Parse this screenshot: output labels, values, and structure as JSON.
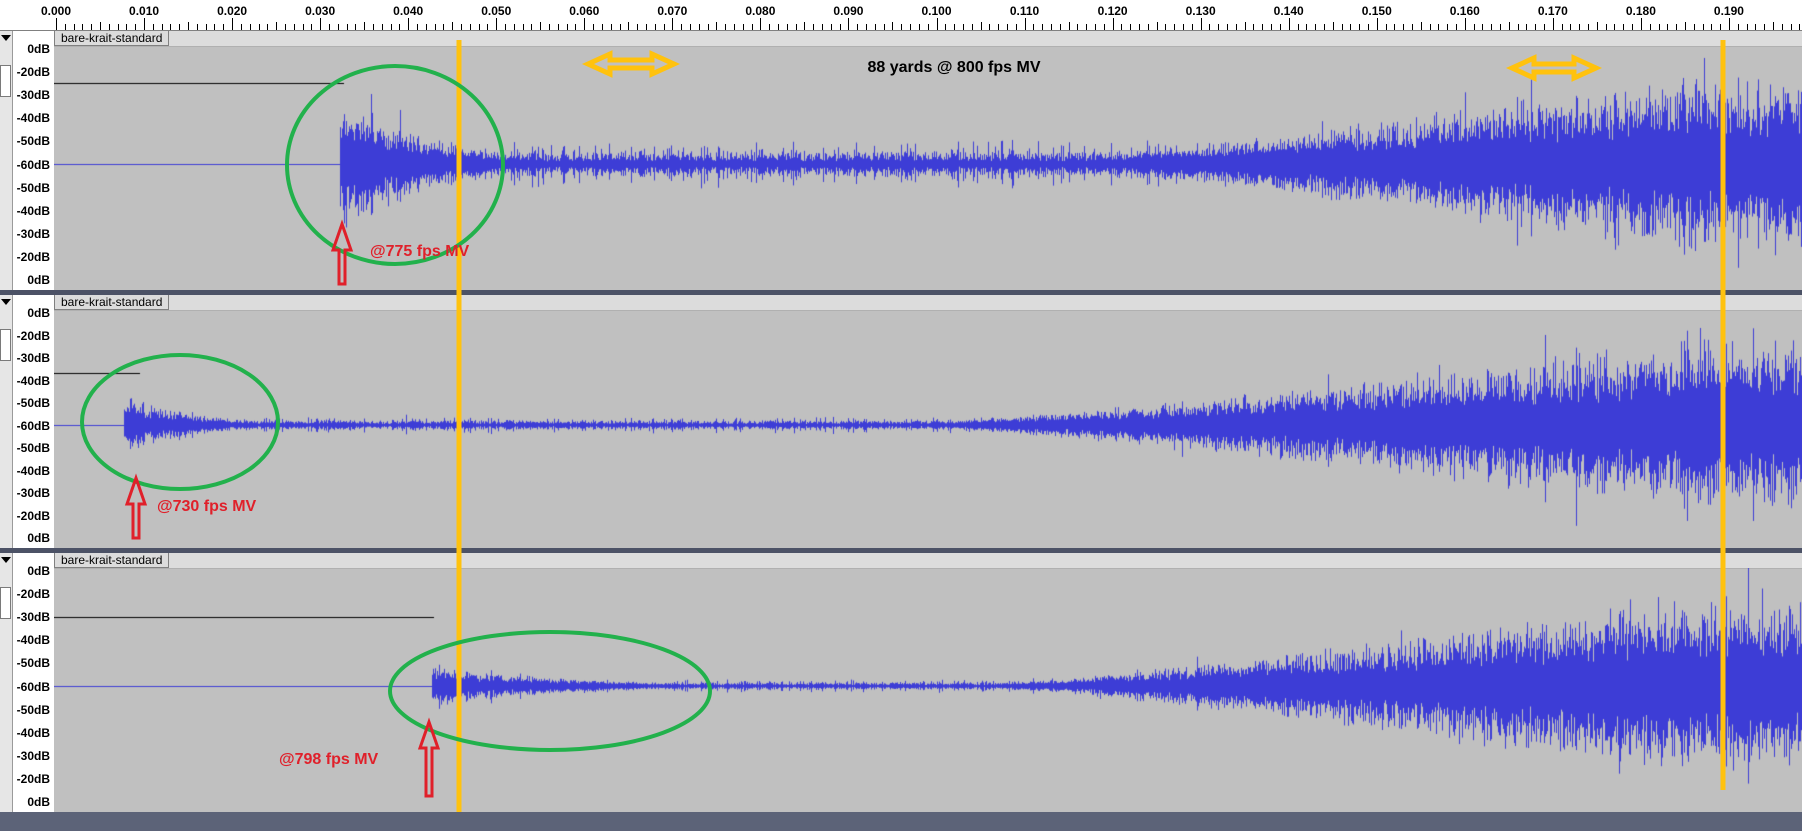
{
  "ruler": {
    "ticks": [
      "0.000",
      "0.010",
      "0.020",
      "0.030",
      "0.040",
      "0.050",
      "0.060",
      "0.070",
      "0.080",
      "0.090",
      "0.100",
      "0.110",
      "0.120",
      "0.130",
      "0.140",
      "0.150",
      "0.160",
      "0.170",
      "0.180",
      "0.190"
    ]
  },
  "tracks": [
    {
      "clip_name": "bare-krait-standard",
      "db_labels": [
        "0dB",
        "-20dB",
        "-30dB",
        "-40dB",
        "-50dB",
        "-60dB",
        "-50dB",
        "-40dB",
        "-30dB",
        "-20dB",
        "0dB"
      ],
      "annotation": "@775 fps MV"
    },
    {
      "clip_name": "bare-krait-standard",
      "db_labels": [
        "0dB",
        "-20dB",
        "-30dB",
        "-40dB",
        "-50dB",
        "-60dB",
        "-50dB",
        "-40dB",
        "-30dB",
        "-20dB",
        "0dB"
      ],
      "annotation": "@730 fps MV"
    },
    {
      "clip_name": "bare-krait-standard",
      "db_labels": [
        "0dB",
        "-20dB",
        "-30dB",
        "-40dB",
        "-50dB",
        "-60dB",
        "-50dB",
        "-40dB",
        "-30dB",
        "-20dB",
        "0dB"
      ],
      "annotation": "@798 fps MV"
    }
  ],
  "headline": "88 yards @ 800 fps MV",
  "colors": {
    "waveform": "#3d3dd6",
    "circle": "#22b14c",
    "marker_line": "#ffc20e",
    "annotation": "#e0202a"
  }
}
